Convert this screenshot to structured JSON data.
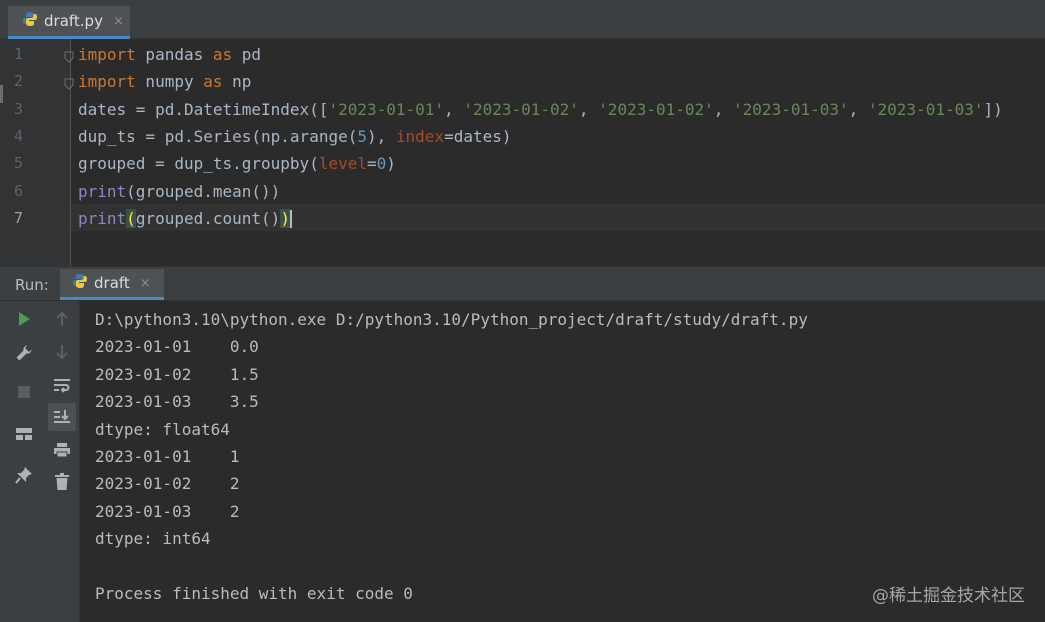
{
  "editor_tab": {
    "title": "draft.py",
    "close": "×"
  },
  "code_lines": [
    {
      "n": "1",
      "parts": [
        [
          "kw",
          "import"
        ],
        [
          "p",
          " pandas "
        ],
        [
          "kw",
          "as"
        ],
        [
          "p",
          " pd"
        ]
      ]
    },
    {
      "n": "2",
      "parts": [
        [
          "kw",
          "import"
        ],
        [
          "p",
          " numpy "
        ],
        [
          "kw",
          "as"
        ],
        [
          "p",
          " np"
        ]
      ]
    },
    {
      "n": "3",
      "parts": [
        [
          "p",
          "dates = pd.DatetimeIndex(["
        ],
        [
          "str",
          "'2023-01-01'"
        ],
        [
          "p",
          ", "
        ],
        [
          "str",
          "'2023-01-02'"
        ],
        [
          "p",
          ", "
        ],
        [
          "str",
          "'2023-01-02'"
        ],
        [
          "p",
          ", "
        ],
        [
          "str",
          "'2023-01-03'"
        ],
        [
          "p",
          ", "
        ],
        [
          "str",
          "'2023-01-03'"
        ],
        [
          "p",
          "])"
        ]
      ]
    },
    {
      "n": "4",
      "parts": [
        [
          "p",
          "dup_ts = pd.Series(np.arange("
        ],
        [
          "num",
          "5"
        ],
        [
          "p",
          "), "
        ],
        [
          "kwarg",
          "index"
        ],
        [
          "p",
          "=dates)"
        ]
      ]
    },
    {
      "n": "5",
      "parts": [
        [
          "p",
          "grouped = dup_ts.groupby("
        ],
        [
          "kwarg",
          "level"
        ],
        [
          "p",
          "="
        ],
        [
          "num",
          "0"
        ],
        [
          "p",
          ")"
        ]
      ]
    },
    {
      "n": "6",
      "parts": [
        [
          "bi",
          "print"
        ],
        [
          "p",
          "(grouped.mean())"
        ]
      ]
    },
    {
      "n": "7",
      "parts": [
        [
          "bi",
          "print"
        ],
        [
          "hl",
          "("
        ],
        [
          "p",
          "grouped.count()"
        ],
        [
          "hl",
          ")"
        ],
        [
          "caret",
          ""
        ]
      ]
    }
  ],
  "current_line": 7,
  "run_panel": {
    "label": "Run:",
    "tab_title": "draft",
    "tab_close": "×"
  },
  "left_toolbar": [
    "run-icon",
    "wrench-icon",
    "stop-icon",
    "layout-icon",
    "pin-icon"
  ],
  "right_toolbar": [
    "up-arrow-icon",
    "down-arrow-icon",
    "soft-wrap-icon",
    "scroll-to-end-icon",
    "print-icon",
    "trash-icon"
  ],
  "console_lines": [
    "D:\\python3.10\\python.exe D:/python3.10/Python_project/draft/study/draft.py",
    "2023-01-01    0.0",
    "2023-01-02    1.5",
    "2023-01-03    3.5",
    "dtype: float64",
    "2023-01-01    1",
    "2023-01-02    2",
    "2023-01-03    2",
    "dtype: int64",
    "",
    "Process finished with exit code 0"
  ],
  "watermark": "@稀土掘金技术社区",
  "colors": {
    "keyword": "#cc7832",
    "string": "#6a8759",
    "number": "#6897bb",
    "kwarg": "#aa4926",
    "builtin": "#8888c6",
    "text": "#a9b7c6",
    "accent": "#4a88c7"
  }
}
